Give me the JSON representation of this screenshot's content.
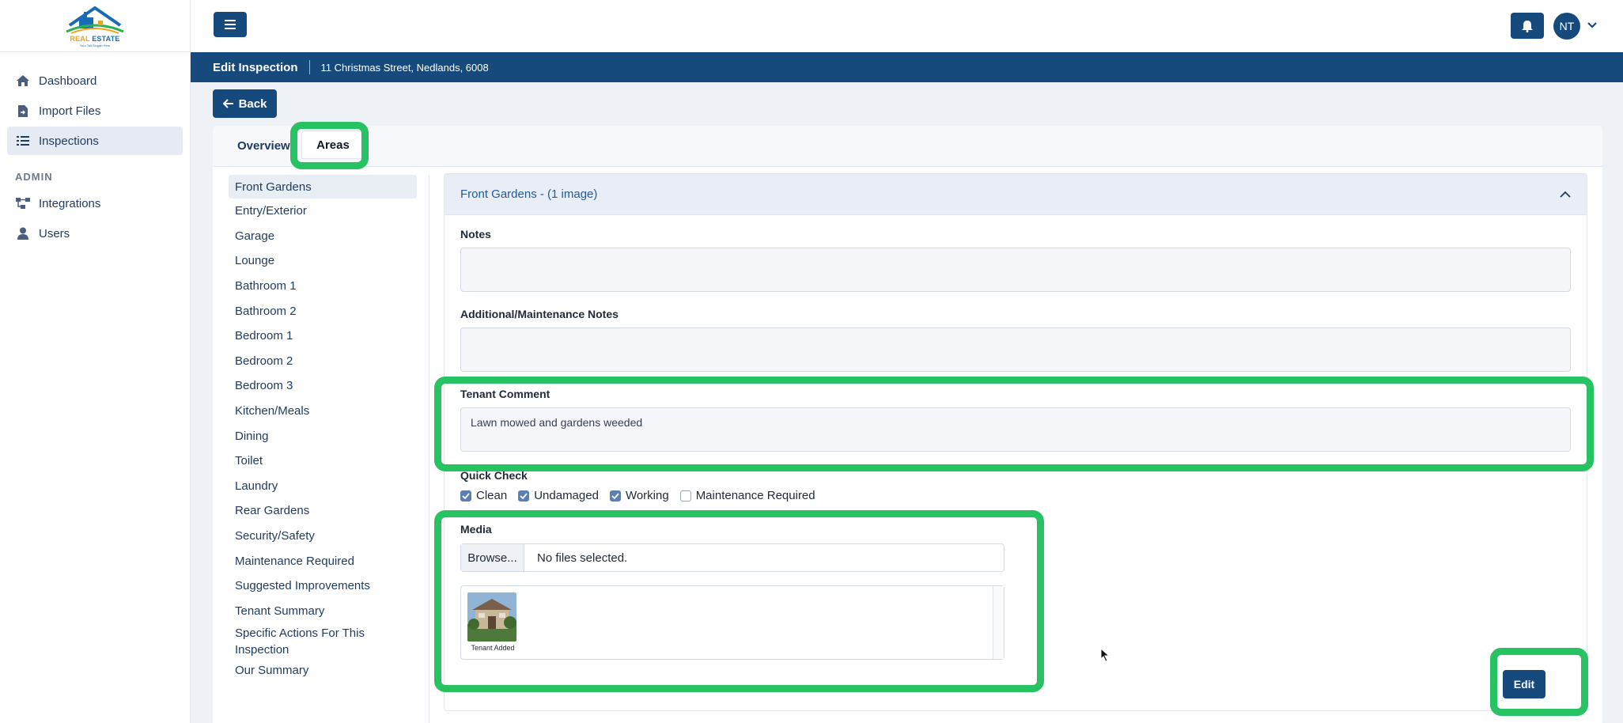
{
  "brand": {
    "logo_word_1": "REAL",
    "logo_word_2": "ESTATE",
    "logo_tagline": "Your Tall Slogan Here"
  },
  "sidebar": {
    "items": [
      {
        "label": "Dashboard",
        "icon": "home-icon"
      },
      {
        "label": "Import Files",
        "icon": "file-import-icon"
      },
      {
        "label": "Inspections",
        "icon": "list-icon",
        "active": true
      }
    ],
    "admin_heading": "ADMIN",
    "admin_items": [
      {
        "label": "Integrations",
        "icon": "integrations-icon"
      },
      {
        "label": "Users",
        "icon": "user-icon"
      }
    ]
  },
  "topbar": {
    "avatar_initials": "NT"
  },
  "header": {
    "title": "Edit Inspection",
    "address": "11 Christmas Street, Nedlands, 6008"
  },
  "back_label": "Back",
  "tabs": [
    {
      "label": "Overview"
    },
    {
      "label": "Areas",
      "active": true
    }
  ],
  "areas": [
    "Front Gardens",
    "Entry/Exterior",
    "Garage",
    "Lounge",
    "Bathroom 1",
    "Bathroom 2",
    "Bedroom 1",
    "Bedroom 2",
    "Bedroom 3",
    "Kitchen/Meals",
    "Dining",
    "Toilet",
    "Laundry",
    "Rear Gardens",
    "Security/Safety",
    "Maintenance Required",
    "Suggested Improvements",
    "Tenant Summary",
    "Specific Actions For This Inspection",
    "Our Summary"
  ],
  "panel": {
    "title": "Front Gardens - (1 image)",
    "notes_label": "Notes",
    "notes_value": "",
    "additional_label": "Additional/Maintenance Notes",
    "additional_value": "",
    "tenant_label": "Tenant Comment",
    "tenant_value": "Lawn mowed and gardens weeded",
    "quick_check_label": "Quick Check",
    "quick_checks": [
      {
        "label": "Clean",
        "checked": true
      },
      {
        "label": "Undamaged",
        "checked": true
      },
      {
        "label": "Working",
        "checked": true
      },
      {
        "label": "Maintenance Required",
        "checked": false
      }
    ],
    "media_label": "Media",
    "browse_label": "Browse...",
    "file_status": "No files selected.",
    "thumb_caption": "Tenant Added",
    "edit_label": "Edit"
  },
  "colors": {
    "primary": "#174a7c",
    "highlight": "#27c261",
    "link": "#1f5b96"
  }
}
